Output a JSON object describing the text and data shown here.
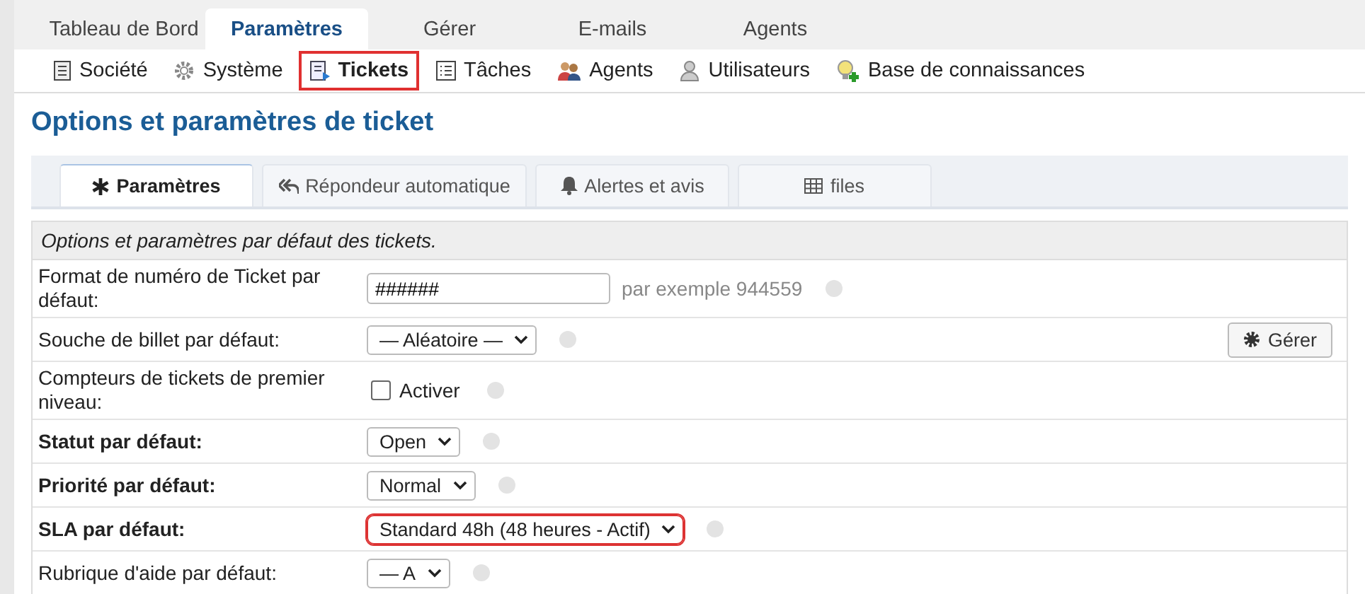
{
  "top_tabs": [
    {
      "label": "Tableau de Bord",
      "selected": false
    },
    {
      "label": "Paramètres",
      "selected": true
    },
    {
      "label": "Gérer",
      "selected": false
    },
    {
      "label": "E-mails",
      "selected": false
    },
    {
      "label": "Agents",
      "selected": false
    }
  ],
  "sub_nav": [
    {
      "label": "Société",
      "selected": false,
      "highlighted": false
    },
    {
      "label": "Système",
      "selected": false,
      "highlighted": false
    },
    {
      "label": "Tickets",
      "selected": true,
      "highlighted": true
    },
    {
      "label": "Tâches",
      "selected": false,
      "highlighted": false
    },
    {
      "label": "Agents",
      "selected": false,
      "highlighted": false
    },
    {
      "label": "Utilisateurs",
      "selected": false,
      "highlighted": false
    },
    {
      "label": "Base de connaissances",
      "selected": false,
      "highlighted": false
    }
  ],
  "title": "Options et paramètres de ticket",
  "tabs": [
    {
      "label": "Paramètres",
      "selected": true
    },
    {
      "label": "Répondeur automatique",
      "selected": false
    },
    {
      "label": "Alertes et avis",
      "selected": false
    },
    {
      "label": "files",
      "selected": false
    }
  ],
  "section_header": "Options et paramètres par défaut des tickets.",
  "rows": [
    {
      "label": "Format de numéro de Ticket par défaut:",
      "bold": false,
      "kind": "text",
      "value": "######",
      "hint": "par exemple 944559",
      "highlighted": false
    },
    {
      "label": "Souche de billet par défaut:",
      "bold": false,
      "kind": "select",
      "value": "— Aléatoire —",
      "button": "Gérer",
      "highlighted": false
    },
    {
      "label": "Compteurs de tickets de premier niveau:",
      "bold": false,
      "kind": "checkbox",
      "value": "Activer",
      "checked": false,
      "highlighted": false
    },
    {
      "label": "Statut par défaut:",
      "bold": true,
      "kind": "select",
      "value": "Open",
      "highlighted": false
    },
    {
      "label": "Priorité par défaut:",
      "bold": true,
      "kind": "select",
      "value": "Normal",
      "highlighted": false
    },
    {
      "label": "SLA par défaut:",
      "bold": true,
      "kind": "select",
      "value": "Standard 48h (48 heures - Actif)",
      "highlighted": true
    },
    {
      "label": "Rubrique d'aide par défaut:",
      "bold": false,
      "kind": "select",
      "value": "— A",
      "highlighted": false
    }
  ]
}
